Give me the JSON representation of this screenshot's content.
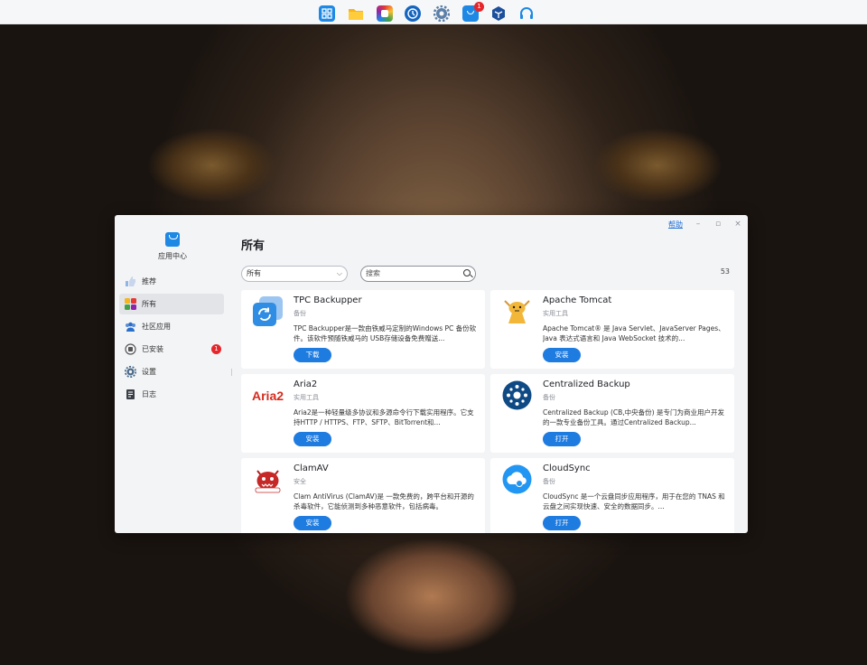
{
  "taskbar": {
    "icons": [
      "app-grid-icon",
      "folder-icon",
      "photo-app-icon",
      "clock-icon",
      "settings-gear-icon",
      "app-center-icon",
      "shield-box-icon",
      "headset-icon"
    ],
    "app_center_badge": "1"
  },
  "window": {
    "help_label": "帮助",
    "minimize_label": "–",
    "maximize_label": "▫",
    "close_label": "×"
  },
  "sidebar": {
    "app_title": "应用中心",
    "items": [
      {
        "label": "推荐",
        "icon": "thumb-up-icon"
      },
      {
        "label": "所有",
        "icon": "apps-grid-icon",
        "active": true
      },
      {
        "label": "社区应用",
        "icon": "community-icon"
      },
      {
        "label": "已安装",
        "icon": "installed-icon",
        "badge": "1"
      },
      {
        "label": "设置",
        "icon": "gear-icon"
      },
      {
        "label": "日志",
        "icon": "log-icon"
      }
    ]
  },
  "main": {
    "title": "所有",
    "filter_value": "所有",
    "search_placeholder": "搜索",
    "count": "53",
    "cards": [
      {
        "name": "TPC Backupper",
        "category": "备份",
        "description": "TPC Backupper是一款由铁威马定制的Windows PC 备份软件。该软件预随铁威马的 USB存储设备免费赠送...",
        "button": "下载"
      },
      {
        "name": "Apache Tomcat",
        "category": "实用工具",
        "description": "Apache Tomcat® 是 Java Servlet、JavaServer Pages、Java 表达式语言和 Java WebSocket 技术的...",
        "button": "安装"
      },
      {
        "name": "Aria2",
        "category": "实用工具",
        "description": "Aria2是一种轻量级多协议和多源命令行下载实用程序。它支持HTTP / HTTPS、FTP、SFTP、BitTorrent和...",
        "button": "安装"
      },
      {
        "name": "Centralized Backup",
        "category": "备份",
        "description": "Centralized Backup (CB,中央备份) 是专门为商业用户开发的一款专业备份工具。通过Centralized Backup...",
        "button": "打开"
      },
      {
        "name": "ClamAV",
        "category": "安全",
        "description": "Clam AntiVirus (ClamAV)是 一款免费的，跨平台和开源的杀毒软件，它能侦测到多种恶意软件，包括病毒。",
        "button": "安装"
      },
      {
        "name": "CloudSync",
        "category": "备份",
        "description": "CloudSync 是一个云盘同步应用程序，用于在您的 TNAS 和云盘之间实现快速、安全的数据同步。...",
        "button": "打开"
      }
    ]
  },
  "colors": {
    "accent": "#1e7be0",
    "badge": "#e5262b"
  }
}
